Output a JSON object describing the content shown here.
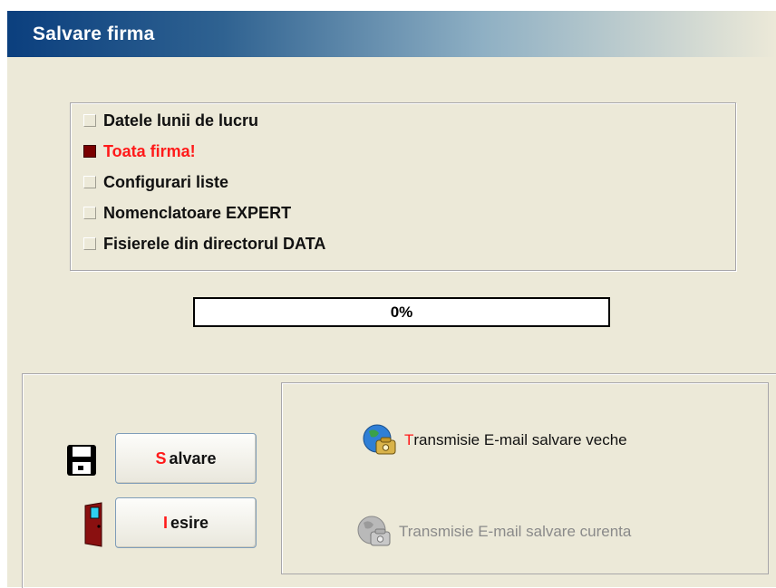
{
  "window": {
    "title": "Salvare firma"
  },
  "options": [
    {
      "label": "Datele lunii de lucru",
      "checked": false
    },
    {
      "label": "Toata firma!",
      "checked": true
    },
    {
      "label": "Configurari liste",
      "checked": false
    },
    {
      "label": "Nomenclatoare EXPERT",
      "checked": false
    },
    {
      "label": "Fisierele din directorul DATA",
      "checked": false
    }
  ],
  "progress": {
    "text": "0%",
    "value": 0
  },
  "buttons": {
    "save": {
      "hotkey": "S",
      "rest": "alvare"
    },
    "exit": {
      "hotkey": "I",
      "rest": "esire"
    }
  },
  "email": {
    "old": {
      "hotkey": "T",
      "rest": "ransmisie E-mail salvare veche",
      "enabled": true
    },
    "current": {
      "text": "Transmisie E-mail salvare curenta",
      "enabled": false
    }
  },
  "colors": {
    "accent_text": "#ff1a1a",
    "title_bar": "#0b3f7e",
    "checked_box": "#7a0000"
  },
  "icons": {
    "save": "floppy-disk-icon",
    "exit": "door-icon",
    "email": "globe-phone-icon"
  }
}
